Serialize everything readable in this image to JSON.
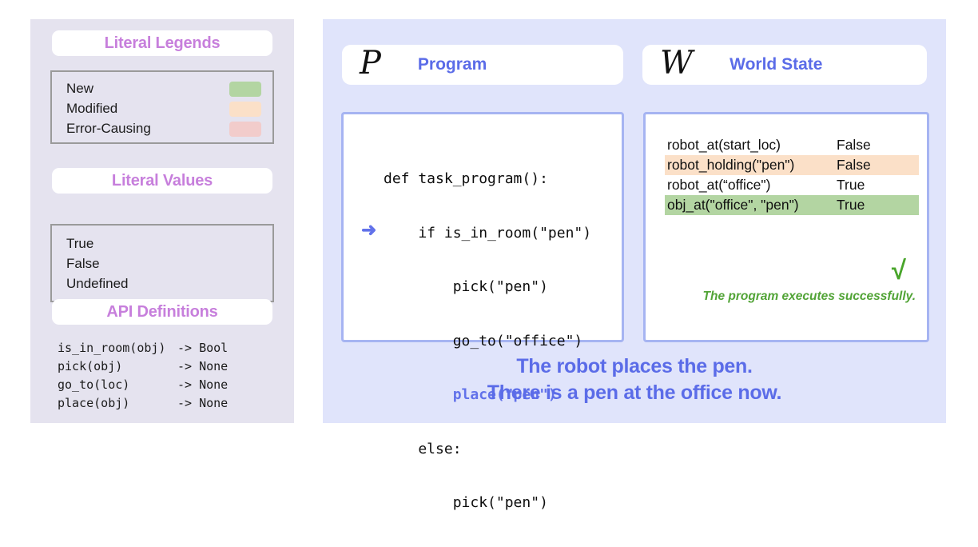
{
  "colors": {
    "left_panel_bg": "#e5e3ef",
    "right_panel_bg": "#e0e4fb",
    "purple_title": "#c77fdc",
    "blue_title": "#5b6ce8",
    "box_border": "#a6b4f2",
    "green_success": "#52a437",
    "new_swatch": "#b3d5a2",
    "modified_swatch": "#fbe0c8",
    "error_swatch": "#f2cccb"
  },
  "left": {
    "legend_section": {
      "title": "Literal Legends",
      "items": [
        {
          "label": "New",
          "color": "#b3d5a2"
        },
        {
          "label": "Modified",
          "color": "#fbe0c8"
        },
        {
          "label": "Error-Causing",
          "color": "#f2cccb"
        }
      ]
    },
    "values_section": {
      "title": "Literal Values",
      "values": [
        "True",
        "False",
        "Undefined"
      ]
    },
    "api_section": {
      "title": "API Definitions",
      "rows": [
        {
          "signature": "is_in_room(obj)",
          "returns": "-> Bool"
        },
        {
          "signature": "pick(obj)",
          "returns": "-> None"
        },
        {
          "signature": "go_to(loc)",
          "returns": "-> None"
        },
        {
          "signature": "place(obj)",
          "returns": "-> None"
        }
      ]
    }
  },
  "right": {
    "program_panel": {
      "glyph": "P",
      "title": "Program",
      "arrow": "➜",
      "code_lines": [
        {
          "text": "def task_program():",
          "highlighted": false
        },
        {
          "text": "    if is_in_room(\"pen\")",
          "highlighted": false
        },
        {
          "text": "        pick(\"pen\")",
          "highlighted": false
        },
        {
          "text": "        go_to(\"office\")",
          "highlighted": false
        },
        {
          "text": "        place(\"pen\")",
          "highlighted": true
        },
        {
          "text": "    else:",
          "highlighted": false
        },
        {
          "text": "        pick(\"pen\")",
          "highlighted": false
        }
      ]
    },
    "world_panel": {
      "glyph": "W",
      "title": "World State",
      "rows": [
        {
          "predicate": "robot_at(start_loc)",
          "value": "False",
          "highlight": "none"
        },
        {
          "predicate": "robot_holding(\"pen\")",
          "value": "False",
          "highlight": "modified"
        },
        {
          "predicate": "robot_at(“office\")",
          "value": "True",
          "highlight": "none"
        },
        {
          "predicate": "obj_at(\"office\", \"pen\")",
          "value": "True",
          "highlight": "new"
        }
      ],
      "check_mark": "√",
      "execution_message": "The program executes successfully."
    },
    "caption_line1": "The robot places the pen.",
    "caption_line2": "There is a pen at the office now."
  }
}
